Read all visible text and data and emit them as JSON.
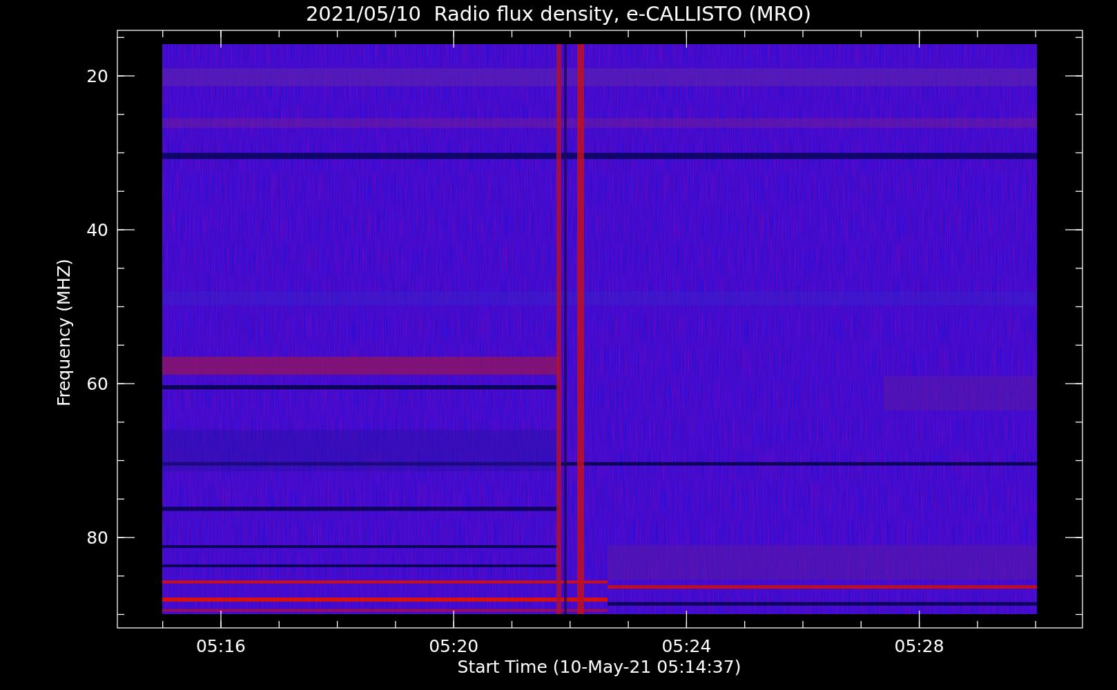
{
  "title": "2021/05/10  Radio flux density, e-CALLISTO (MRO)",
  "y_axis": {
    "label": "Frequency (MHZ)",
    "ticks": [
      "20",
      "40",
      "60",
      "80"
    ]
  },
  "x_axis": {
    "label": "Start Time (10-May-21 05:14:37)",
    "ticks": [
      "05:16",
      "05:20",
      "05:24",
      "05:28"
    ]
  }
}
